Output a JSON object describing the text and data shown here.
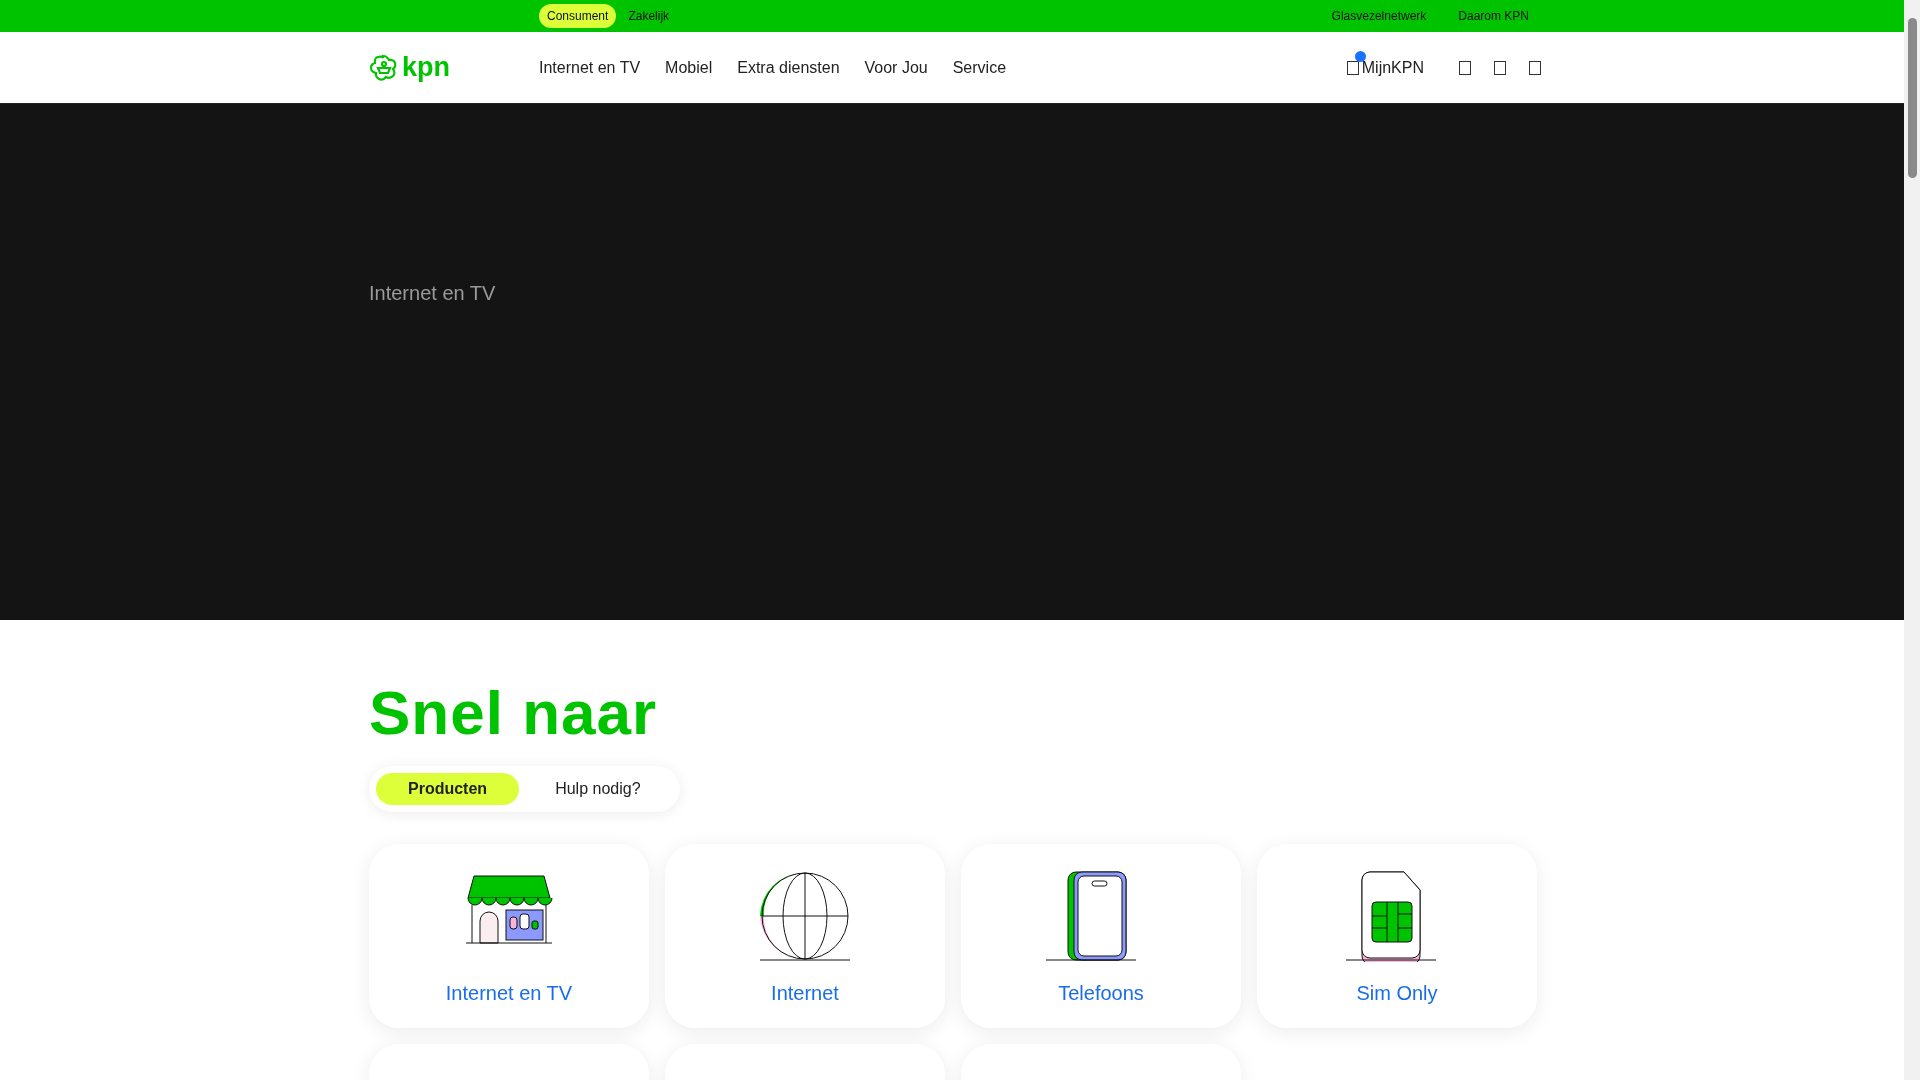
{
  "top_bar": {
    "segments": [
      {
        "label": "Consument",
        "selected": true
      },
      {
        "label": "Zakelijk",
        "selected": false
      }
    ],
    "links": [
      "Glasvezelnetwerk",
      "Daarom KPN"
    ]
  },
  "nav": {
    "logo": "kpn",
    "items": [
      "Internet en TV",
      "Mobiel",
      "Extra diensten",
      "Voor Jou",
      "Service"
    ],
    "account": {
      "label": "MijnKPN",
      "badge": true
    },
    "icons": [
      {
        "kind": "square"
      },
      {
        "kind": "square"
      },
      {
        "kind": "square"
      }
    ]
  },
  "hero": {
    "title": "Internet en TV"
  },
  "quick": {
    "heading": "Snel naar",
    "tabs": [
      {
        "label": "Producten",
        "selected": true
      },
      {
        "label": "Hulp nodig?",
        "selected": false
      }
    ],
    "cards": [
      {
        "kind": "shop",
        "label": "Internet en TV"
      },
      {
        "kind": "globe",
        "label": "Internet"
      },
      {
        "kind": "phone",
        "label": "Telefoons"
      },
      {
        "kind": "sim",
        "label": "Sim Only"
      },
      {
        "kind": "blank"
      },
      {
        "kind": "blank"
      },
      {
        "kind": "blank"
      }
    ]
  }
}
